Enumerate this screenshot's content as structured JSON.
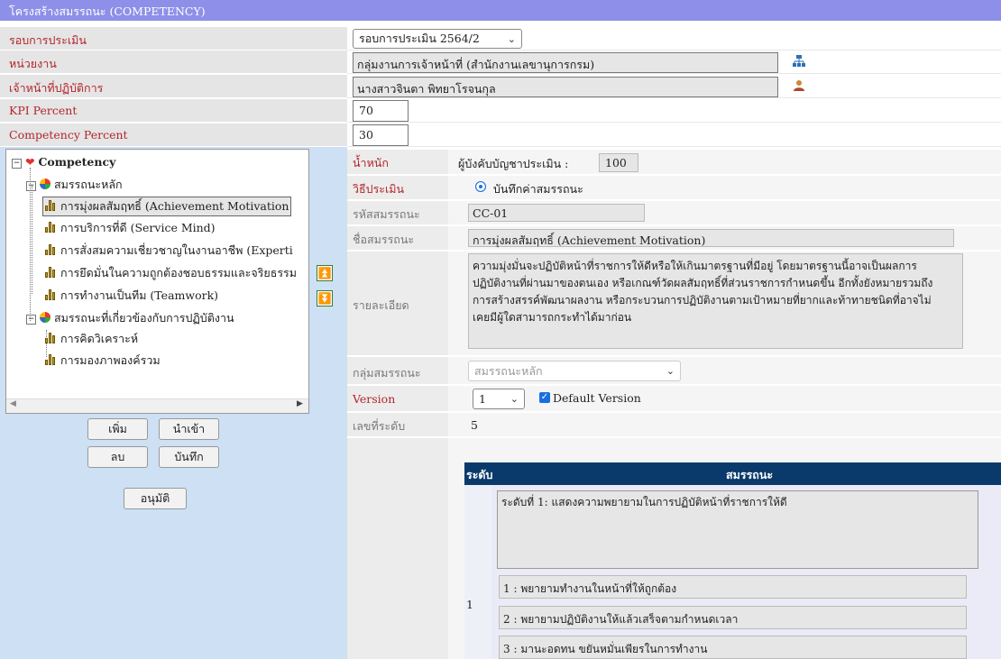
{
  "title": "โครงสร้างสมรรถนะ (COMPETENCY)",
  "top_fields": {
    "round_label": "รอบการประเมิน",
    "round_value": "รอบการประเมิน 2564/2",
    "unit_label": "หน่วยงาน",
    "unit_value": "กลุ่มงานการเจ้าหน้าที่ (สำนักงานเลขานุการกรม)",
    "officer_label": "เจ้าหน้าที่ปฏิบัติการ",
    "officer_value": "นางสาวจินตา พิทยาโรจนกุล",
    "kpi_label": "KPI Percent",
    "kpi_value": "70",
    "comp_label": "Competency Percent",
    "comp_value": "30"
  },
  "tree": {
    "root": "Competency",
    "groups": [
      {
        "label": "สมรรถนะหลัก",
        "items": [
          "การมุ่งผลสัมฤทธิ์ (Achievement Motivation",
          "การบริการที่ดี (Service Mind)",
          "การสั่งสมความเชี่ยวชาญในงานอาชีพ (Experti",
          "การยึดมั่นในความถูกต้องชอบธรรมและจริยธรรม",
          "การทำงานเป็นทีม (Teamwork)"
        ]
      },
      {
        "label": "สมรรถนะที่เกี่ยวข้องกับการปฏิบัติงาน",
        "items": [
          "การคิดวิเคราะห์",
          "การมองภาพองค์รวม"
        ]
      }
    ]
  },
  "buttons": {
    "add": "เพิ่ม",
    "import": "นำเข้า",
    "delete": "ลบ",
    "save": "บันทึก",
    "approve": "อนุมัติ"
  },
  "form": {
    "weight_label": "น้ำหนัก",
    "weight_sub": "ผู้บังคับบัญชาประเมิน :",
    "weight_value": "100",
    "method_label": "วิธีประเมิน",
    "method_option": "บันทึกค่าสมรรถนะ",
    "code_label": "รหัสสมรรถนะ",
    "code_value": "CC-01",
    "name_label": "ชื่อสมรรถนะ",
    "name_value": "การมุ่งผลสัมฤทธิ์ (Achievement Motivation)",
    "detail_label": "รายละเอียด",
    "detail_lines": [
      "ความมุ่งมั่นจะปฏิบัติหน้าที่ราชการให้ดีหรือให้เกินมาตรฐานที่มีอยู่  โดยมาตรฐานนี้อาจเป็นผลการ",
      "ปฏิบัติงานที่ผ่านมาของตนเอง หรือเกณฑ์วัดผลสัมฤทธิ์ที่ส่วนราชการกำหนดขึ้น อีกทั้งยังหมายรวมถึง",
      "การสร้างสรรค์พัฒนาผลงาน หรือกระบวนการปฏิบัติงานตามเป้าหมายที่ยากและท้าทายชนิดที่อาจไม่",
      "เคยมีผู้ใดสามารถกระทำได้มาก่อน"
    ],
    "group_label": "กลุ่มสมรรถนะ",
    "group_value": "สมรรถนะหลัก",
    "version_label": "Version",
    "version_value": "1",
    "default_version": "Default Version",
    "levels_label": "เลขที่ระดับ",
    "levels_value": "5"
  },
  "level_table": {
    "col_level": "ระดับ",
    "col_comp": "สมรรถนะ",
    "level_no": "1",
    "level_desc": "ระดับที่ 1: แสดงความพยายามในการปฏิบัติหน้าที่ราชการให้ดี",
    "behaviors": [
      {
        "no": "1 :",
        "text": "พยายามทำงานในหน้าที่ให้ถูกต้อง"
      },
      {
        "no": "2 :",
        "text": "พยายามปฏิบัติงานให้แล้วเสร็จตามกำหนดเวลา"
      },
      {
        "no": "3 :",
        "text": "มานะอดทน ขยันหมั่นเพียรในการทำงาน"
      }
    ]
  }
}
